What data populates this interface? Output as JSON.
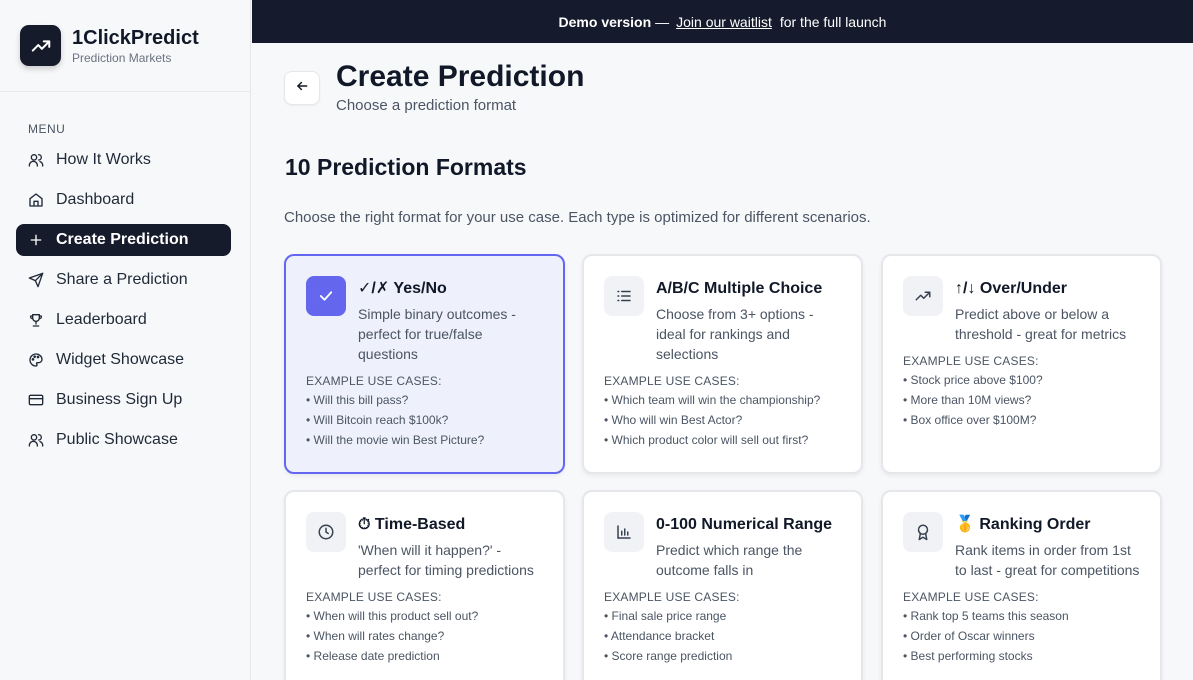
{
  "brand": {
    "name": "1ClickPredict",
    "subtitle": "Prediction Markets"
  },
  "menu_label": "MENU",
  "nav": [
    {
      "label": "How It Works",
      "icon": "users-icon"
    },
    {
      "label": "Dashboard",
      "icon": "home-icon"
    },
    {
      "label": "Create Prediction",
      "icon": "plus-icon",
      "active": true
    },
    {
      "label": "Share a Prediction",
      "icon": "send-icon"
    },
    {
      "label": "Leaderboard",
      "icon": "trophy-icon"
    },
    {
      "label": "Widget Showcase",
      "icon": "palette-icon"
    },
    {
      "label": "Business Sign Up",
      "icon": "credit-card-icon"
    },
    {
      "label": "Public Showcase",
      "icon": "users-icon"
    }
  ],
  "banner": {
    "lead": "Demo version",
    "dash": "—",
    "link": "Join our waitlist",
    "tail": "for the full launch"
  },
  "header": {
    "title": "Create Prediction",
    "subtitle": "Choose a prediction format"
  },
  "section": {
    "title": "10 Prediction Formats",
    "description": "Choose the right format for your use case. Each type is optimized for different scenarios."
  },
  "example_label": "EXAMPLE USE CASES:",
  "cards": [
    {
      "title": "✓/✗ Yes/No",
      "description": "Simple binary outcomes - perfect for true/false questions",
      "icon": "check-icon",
      "selected": true,
      "examples": [
        "Will this bill pass?",
        "Will Bitcoin reach $100k?",
        "Will the movie win Best Picture?"
      ]
    },
    {
      "title": "A/B/C Multiple Choice",
      "description": "Choose from 3+ options - ideal for rankings and selections",
      "icon": "list-icon",
      "examples": [
        "Which team will win the championship?",
        "Who will win Best Actor?",
        "Which product color will sell out first?"
      ]
    },
    {
      "title": "↑/↓ Over/Under",
      "description": "Predict above or below a threshold - great for metrics",
      "icon": "trending-up-icon",
      "examples": [
        "Stock price above $100?",
        "More than 10M views?",
        "Box office over $100M?"
      ]
    },
    {
      "title": "⏱ Time-Based",
      "description": "'When will it happen?' - perfect for timing predictions",
      "icon": "clock-icon",
      "examples": [
        "When will this product sell out?",
        "When will rates change?",
        "Release date prediction"
      ]
    },
    {
      "title": "0-100 Numerical Range",
      "description": "Predict which range the outcome falls in",
      "icon": "bar-chart-icon",
      "examples": [
        "Final sale price range",
        "Attendance bracket",
        "Score range prediction"
      ]
    },
    {
      "title": "🥇 Ranking Order",
      "description": "Rank items in order from 1st to last - great for competitions",
      "icon": "award-icon",
      "examples": [
        "Rank top 5 teams this season",
        "Order of Oscar winners",
        "Best performing stocks"
      ]
    }
  ],
  "colors": {
    "accent": "#6366f1",
    "dark": "#151b2c"
  }
}
